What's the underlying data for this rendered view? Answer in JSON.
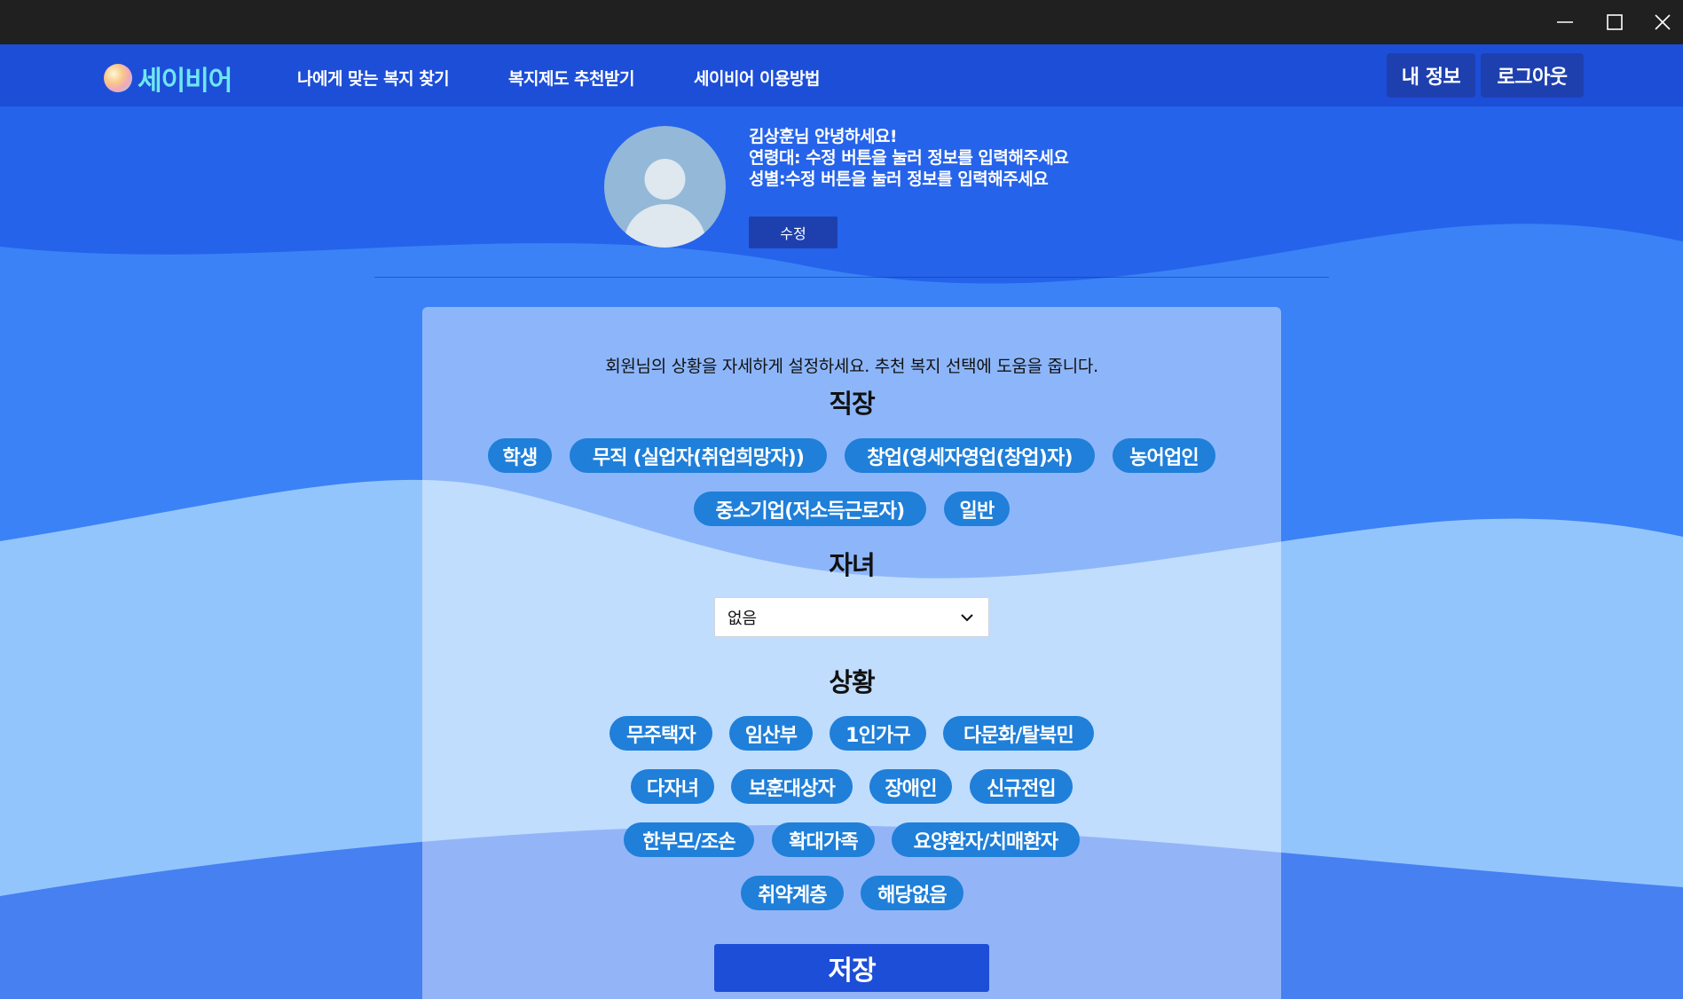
{
  "window": {
    "minimize_label": "minimize",
    "maximize_label": "maximize",
    "close_label": "close"
  },
  "navbar": {
    "logo_text": "세이비어",
    "links": [
      "나에게 맞는 복지 찾기",
      "복지제도 추천받기",
      "세이비어 이용방법"
    ],
    "my_info_label": "내 정보",
    "logout_label": "로그아웃"
  },
  "profile": {
    "greeting": "김상훈님 안녕하세요!",
    "age_line": "연령대: 수정 버튼을 눌러 정보를 입력해주세요",
    "gender_line": "성별:수정 버튼을 눌러 정보를 입력해주세요",
    "edit_label": "수정"
  },
  "settings": {
    "description": "회원님의 상황을 자세하게 설정하세요. 추천 복지 선택에 도움을 줍니다.",
    "job": {
      "title": "직장",
      "options": [
        "학생",
        "무직 (실업자(취업희망자))",
        "창업(영세자영업(창업)자)",
        "농어업인",
        "중소기업(저소득근로자)",
        "일반"
      ]
    },
    "children": {
      "title": "자녀",
      "selected": "없음"
    },
    "situation": {
      "title": "상황",
      "options": [
        "무주택자",
        "임산부",
        "1인가구",
        "다문화/탈북민",
        "다자녀",
        "보훈대상자",
        "장애인",
        "신규전입",
        "한부모/조손",
        "확대가족",
        "요양환자/치매환자",
        "취약계층",
        "해당없음"
      ]
    },
    "save_label": "저장"
  },
  "colors": {
    "background": "#2563eb",
    "navbar": "#1d4ed8",
    "button_dark": "#1e40af",
    "chip": "#1f7fd9",
    "logo_text": "#6ee7f0"
  }
}
